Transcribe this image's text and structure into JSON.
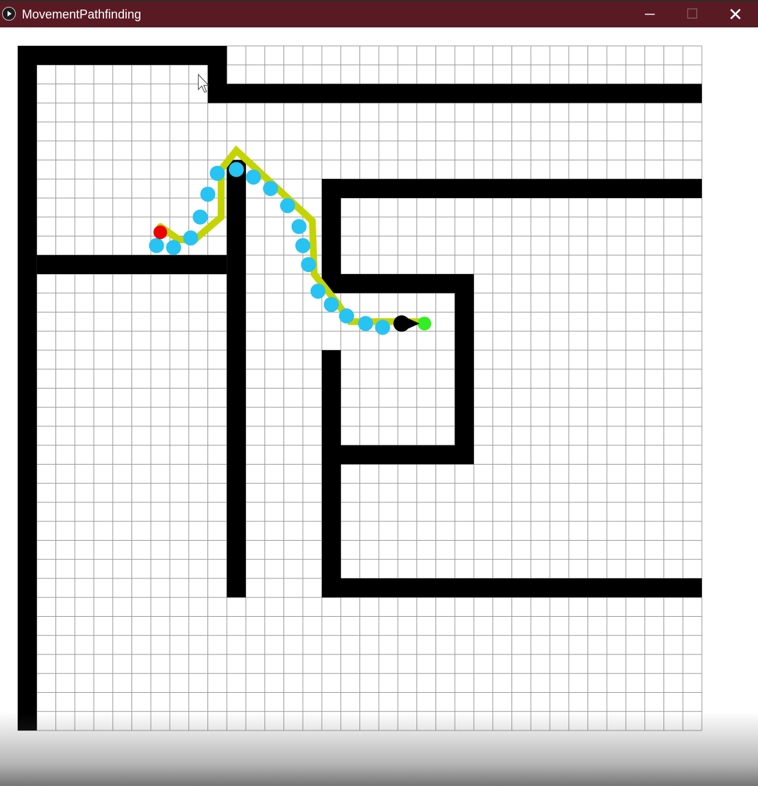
{
  "window": {
    "title": "MovementPathfinding",
    "minimize_glyph": "─",
    "maximize_glyph": "☐",
    "close_glyph": "✕"
  },
  "icons": {
    "app": "play-icon",
    "minimize": "minimize-icon",
    "maximize": "maximize-icon",
    "close": "close-icon",
    "cursor": "mouse-cursor-icon"
  },
  "colors": {
    "titlebar": "#5a1a24",
    "wall": "#000000",
    "grid_line": "#9a9a9a",
    "path": "#c3d400",
    "waypoint": "#27c3f2",
    "start": "#ee0000",
    "goal": "#33ee22",
    "agent": "#000000"
  },
  "grid": {
    "columns": 36,
    "rows": 36
  },
  "walls": [
    [
      0,
      0,
      11,
      1
    ],
    [
      10,
      0,
      11,
      3
    ],
    [
      10,
      2,
      36,
      3
    ],
    [
      0,
      0,
      1,
      36
    ],
    [
      1,
      11,
      11,
      12
    ],
    [
      11,
      6,
      12,
      29
    ],
    [
      16,
      7,
      36,
      8
    ],
    [
      16,
      7,
      17,
      13
    ],
    [
      16,
      12,
      24,
      13
    ],
    [
      23,
      12,
      24,
      22
    ],
    [
      16,
      16,
      17,
      29
    ],
    [
      16,
      21,
      24,
      22
    ],
    [
      16,
      28,
      36,
      29
    ]
  ],
  "path": [
    [
      7.5,
      9.5
    ],
    [
      8.5,
      10.2
    ],
    [
      9.3,
      10.2
    ],
    [
      10.7,
      9.0
    ],
    [
      10.7,
      6.5
    ],
    [
      11.5,
      5.5
    ],
    [
      15.5,
      9.2
    ],
    [
      15.6,
      12.0
    ],
    [
      16.8,
      13.5
    ],
    [
      17.5,
      14.5
    ],
    [
      20.5,
      14.5
    ],
    [
      21.4,
      14.5
    ]
  ],
  "waypoints": [
    [
      7.3,
      10.5
    ],
    [
      8.2,
      10.6
    ],
    [
      9.1,
      10.1
    ],
    [
      9.6,
      9.0
    ],
    [
      10.0,
      7.8
    ],
    [
      10.5,
      6.7
    ],
    [
      11.5,
      6.5
    ],
    [
      12.4,
      6.9
    ],
    [
      13.3,
      7.5
    ],
    [
      14.2,
      8.4
    ],
    [
      14.8,
      9.5
    ],
    [
      15.0,
      10.5
    ],
    [
      15.3,
      11.5
    ],
    [
      15.8,
      12.9
    ],
    [
      16.5,
      13.6
    ],
    [
      17.3,
      14.2
    ],
    [
      18.3,
      14.6
    ],
    [
      19.2,
      14.8
    ]
  ],
  "start": [
    7.5,
    9.8
  ],
  "goal": [
    21.4,
    14.6
  ],
  "agent": [
    20.2,
    14.6
  ],
  "cursor": [
    9.5,
    1.5
  ]
}
